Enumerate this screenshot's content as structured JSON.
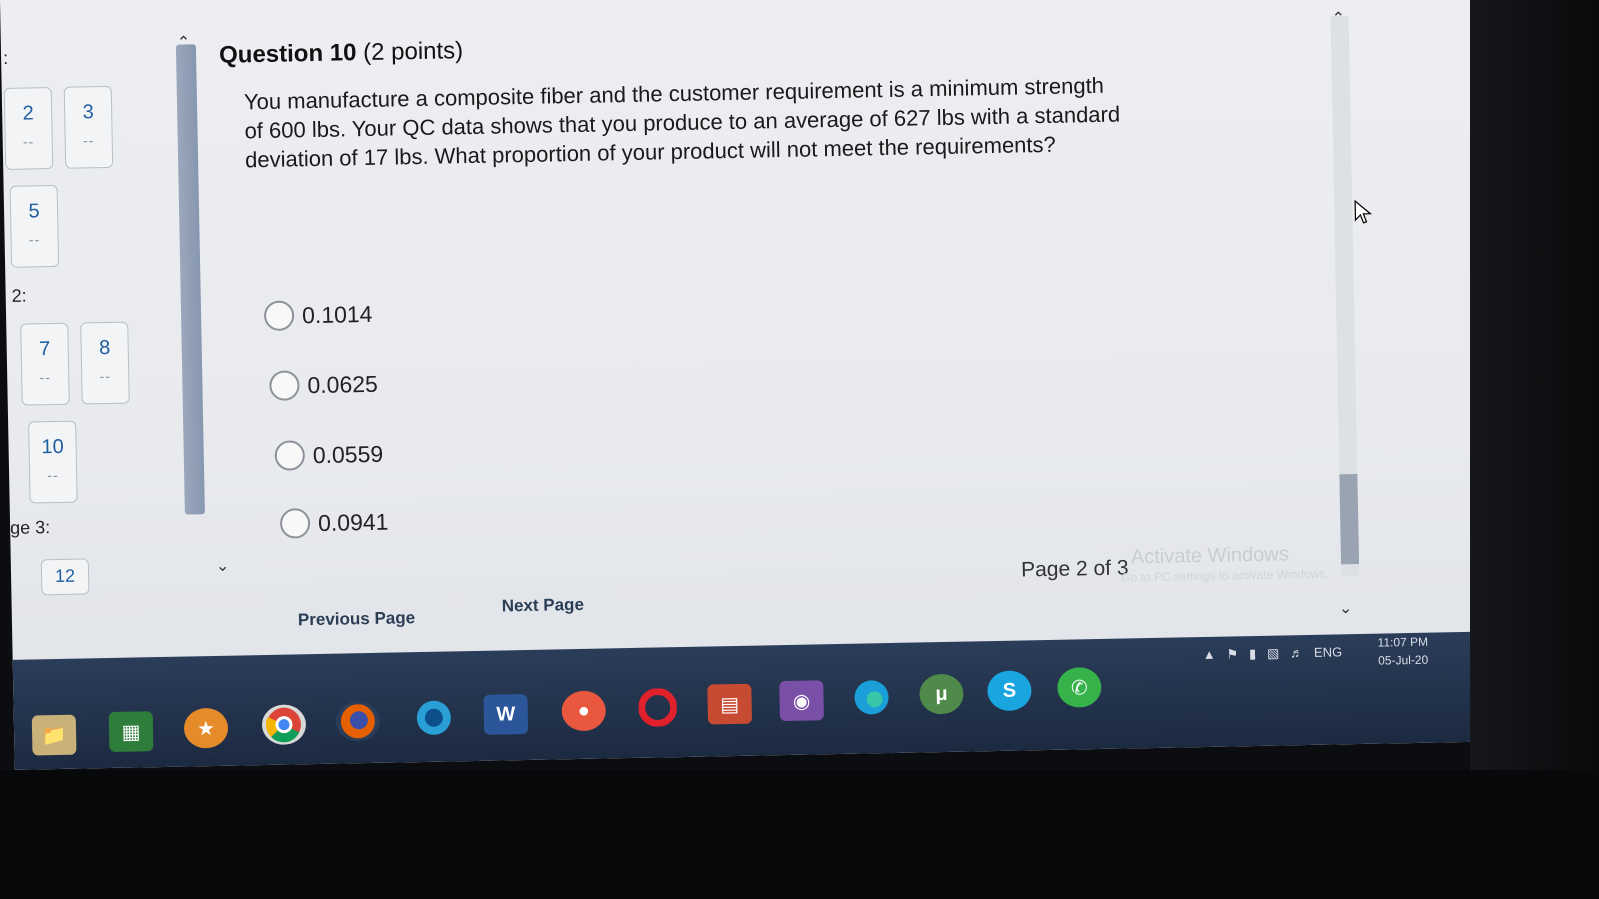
{
  "nav": {
    "top_label": ":",
    "section2_label": "2:",
    "section3_label": "ge 3:",
    "questions": [
      {
        "num": "2",
        "status": "--"
      },
      {
        "num": "3",
        "status": "--"
      },
      {
        "num": "5",
        "status": "--"
      },
      {
        "num": "7",
        "status": "--"
      },
      {
        "num": "8",
        "status": "--"
      },
      {
        "num": "10",
        "status": "--"
      },
      {
        "num": "12",
        "status": ""
      }
    ]
  },
  "question": {
    "title": "Question 10",
    "points": "(2 points)",
    "text": "You manufacture a composite fiber and the customer requirement is a minimum strength of 600 lbs. Your QC data shows that you produce to an average of 627 lbs with a standard deviation of 17 lbs. What proportion of your product will not meet the requirements?",
    "options": [
      "0.1014",
      "0.0625",
      "0.0559",
      "0.0941"
    ]
  },
  "pager": {
    "previous_label": "Previous Page",
    "next_label": "Next Page",
    "page_indicator": "Page 2 of 3"
  },
  "watermark": {
    "title": "Activate Windows",
    "subtitle": "Go to PC settings to activate Windows."
  },
  "taskbar": {
    "icons": [
      "file-explorer-icon",
      "store-icon",
      "uc-browser-icon",
      "chrome-icon",
      "firefox-icon",
      "browser-icon",
      "word-icon",
      "app-icon",
      "opera-icon",
      "media-icon",
      "camera-icon",
      "edge-icon",
      "utorrent-icon",
      "skype-icon",
      "whatsapp-icon"
    ],
    "language": "ENG",
    "time": "11:07 PM",
    "date": "05-Jul-20"
  },
  "colors": {
    "link_blue": "#1f5fa0",
    "taskbar": "#2b3d59"
  }
}
